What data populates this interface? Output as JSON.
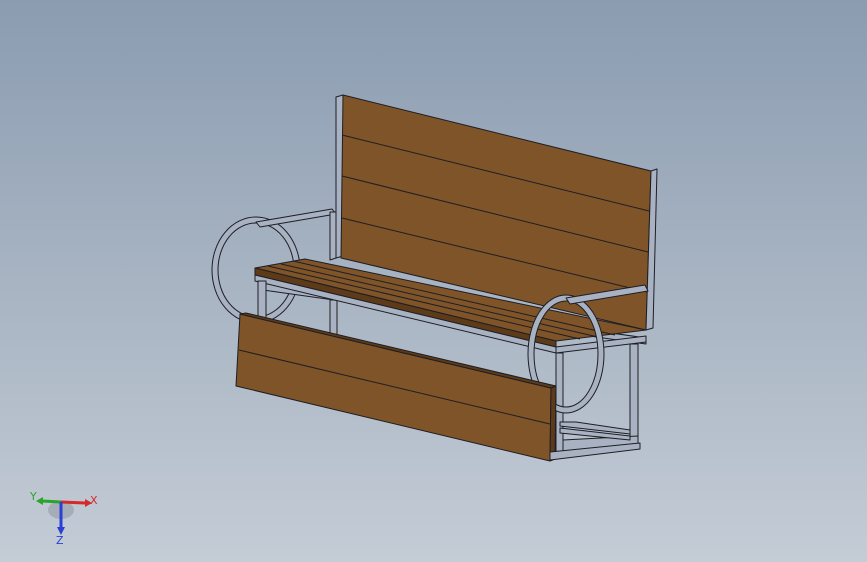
{
  "triad": {
    "x_label": "X",
    "y_label": "Y",
    "z_label": "Z",
    "x_color": "#d42a2a",
    "y_color": "#2aa52a",
    "z_color": "#2a3fd4"
  },
  "model": {
    "wood_color": "#7f5428",
    "wood_dark": "#5e3b18",
    "frame_color": "#a8b2c2",
    "edge_color": "#1e1e24"
  }
}
